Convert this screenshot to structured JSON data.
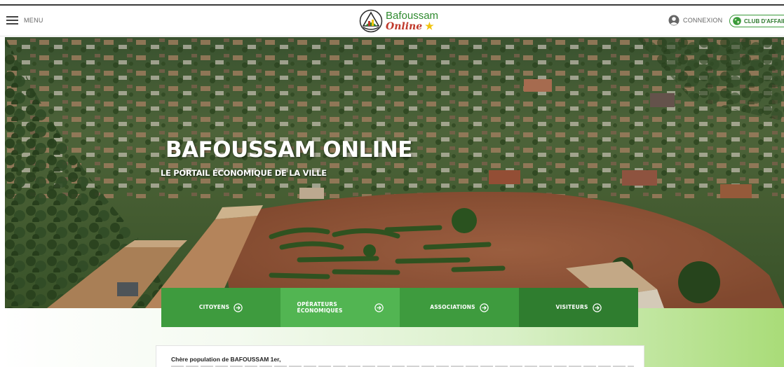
{
  "header": {
    "menu_label": "MENU",
    "logo": {
      "main": "Bafoussam",
      "sub": "Online"
    },
    "login_label": "CONNEXION",
    "club_label": "CLUB D'AFFAIR"
  },
  "hero": {
    "title": "BAFOUSSAM ONLINE",
    "subtitle": "LE PORTAIL ÉCONOMIQUE DE LA VILLE"
  },
  "categories": [
    {
      "label": "CITOYENS"
    },
    {
      "label_line1": "OPÉRATEURS",
      "label_line2": "ÉCONOMIQUES"
    },
    {
      "label": "ASSOCIATIONS"
    },
    {
      "label": "VISITEURS"
    }
  ],
  "welcome": {
    "greeting": "Chère population de BAFOUSSAM 1er,"
  },
  "colors": {
    "brand_green": "#3e9b3e",
    "brand_green_light": "#52b552",
    "brand_green_dark": "#2f7d2f",
    "logo_red": "#c0392b",
    "logo_star": "#f1c40f"
  },
  "icons": [
    "hamburger-icon",
    "logo-emblem",
    "user-icon",
    "globe-icon",
    "arrow-right-circle-icon"
  ]
}
